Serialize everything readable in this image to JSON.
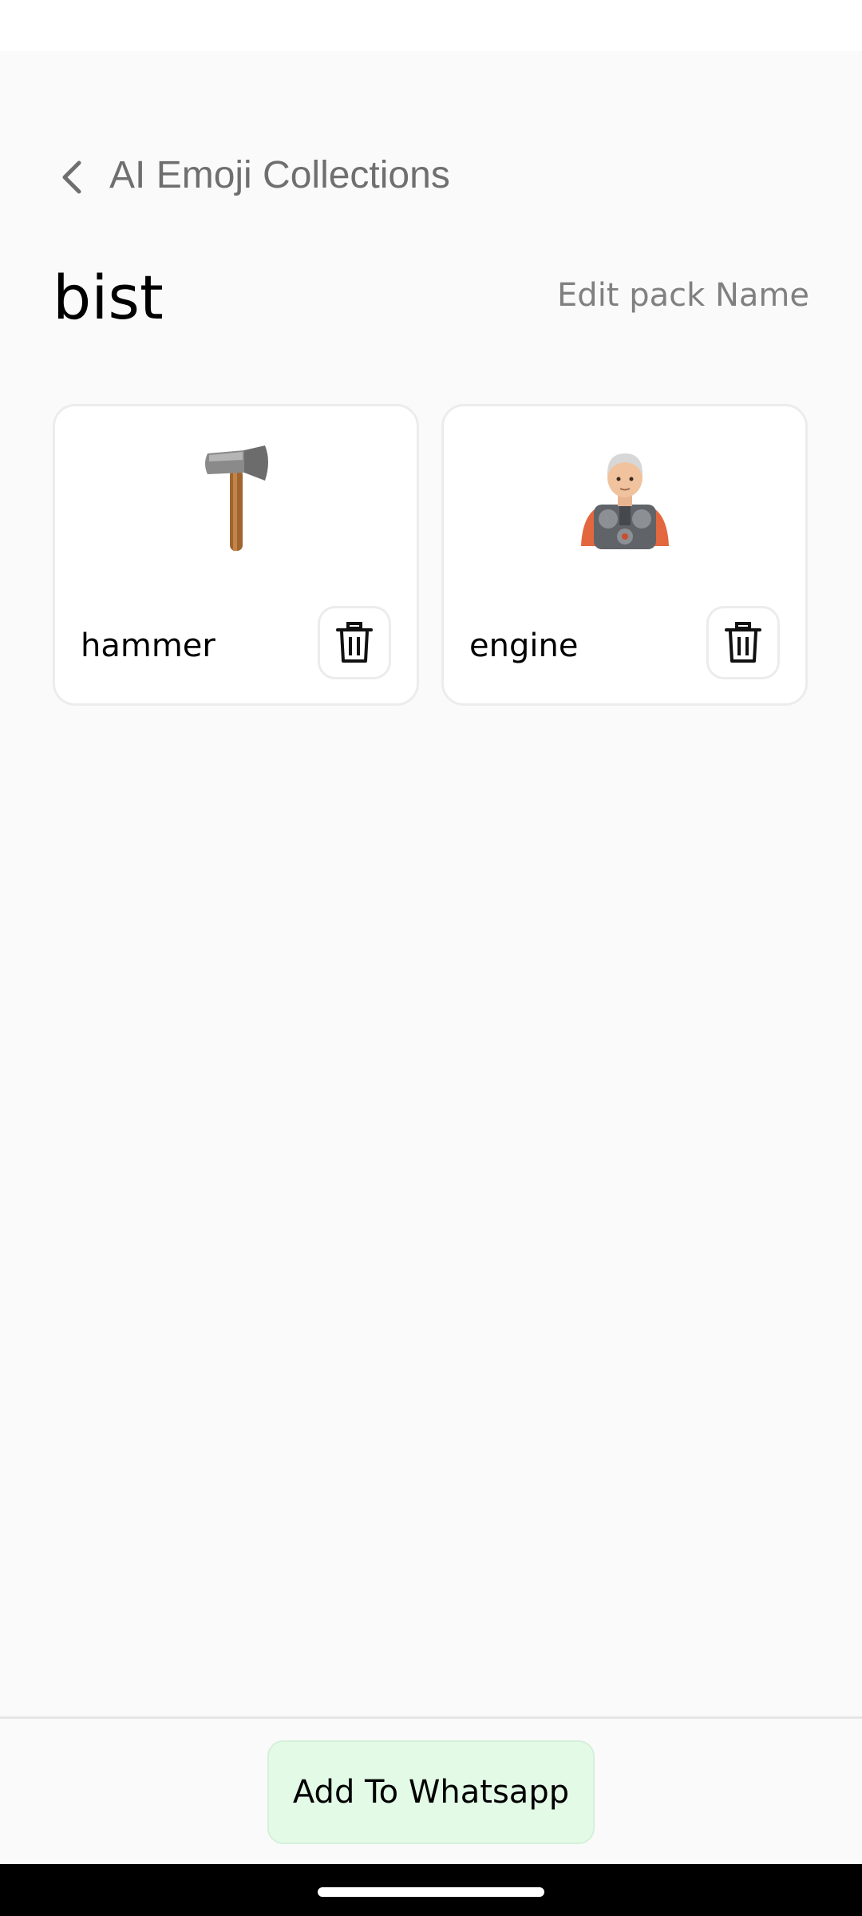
{
  "header": {
    "title": "AI Emoji Collections"
  },
  "pack": {
    "name": "bist",
    "edit_label": "Edit pack Name"
  },
  "stickers": [
    {
      "name": "hammer",
      "icon": "axe-emoji"
    },
    {
      "name": "engine",
      "icon": "man-with-engine-emoji"
    }
  ],
  "footer": {
    "add_label": "Add To Whatsapp"
  },
  "colors": {
    "background": "#fafafa",
    "card_border": "#ececec",
    "add_button_bg": "#e3fae7",
    "muted_text": "#808080"
  }
}
